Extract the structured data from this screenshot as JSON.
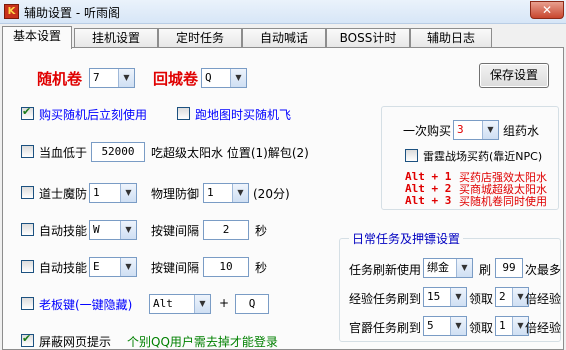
{
  "window": {
    "icon_text": "K",
    "title": "辅助设置 - 听雨阁",
    "close": "✕"
  },
  "tabs": [
    {
      "label": "基本设置",
      "active": true
    },
    {
      "label": "挂机设置",
      "active": false
    },
    {
      "label": "定时任务",
      "active": false
    },
    {
      "label": "自动喊话",
      "active": false
    },
    {
      "label": "BOSS计时",
      "active": false
    },
    {
      "label": "辅助日志",
      "active": false
    }
  ],
  "left": {
    "random_scroll": {
      "label": "随机卷",
      "value": "7"
    },
    "return_scroll": {
      "label": "回城卷",
      "value": "Q"
    },
    "buy_random_use": {
      "label": "购买随机后立刻使用",
      "checked": true
    },
    "run_map_buy": {
      "label": "跑地图时买随机飞",
      "checked": false
    },
    "low_hp": {
      "label": "当血低于",
      "value": "52000",
      "suffix": "吃超级太阳水 位置(1)解包(2)",
      "checked": false
    },
    "taoist_magic_def": {
      "label": "道士魔防",
      "value": "1",
      "phys_label": "物理防御",
      "phys_value": "1",
      "duration": "(20分)",
      "checked": false
    },
    "auto_skill_1": {
      "label": "自动技能",
      "key": "W",
      "interval_label": "按键间隔",
      "interval": "2",
      "unit": "秒",
      "checked": false
    },
    "auto_skill_2": {
      "label": "自动技能",
      "key": "E",
      "interval_label": "按键间隔",
      "interval": "10",
      "unit": "秒",
      "checked": false
    },
    "boss_key": {
      "label": "老板键(一键隐藏)",
      "modifier": "Alt",
      "plus": "+",
      "key": "Q",
      "checked": false
    },
    "block_web": {
      "label": "屏蔽网页提示",
      "checked": true,
      "note": "个别QQ用户需去掉才能登录"
    }
  },
  "right": {
    "save_button": "保存设置",
    "buy_once": {
      "label": "一次购买",
      "value": "3",
      "suffix": "组药水"
    },
    "thunder_buy": {
      "label": "雷霆战场买药(靠近NPC)",
      "checked": false
    },
    "hotkeys": [
      {
        "keys": "Alt + 1",
        "desc": "买药店强效太阳水"
      },
      {
        "keys": "Alt + 2",
        "desc": "买商城超级太阳水"
      },
      {
        "keys": "Alt + 3",
        "desc": "买随机卷同时使用"
      }
    ],
    "daily": {
      "title": "日常任务及押镖设置",
      "refresh_label": "任务刷新使用",
      "refresh_item": "绑金",
      "refresh_word": "刷",
      "refresh_count": "99",
      "refresh_suffix": "次最多",
      "exp_label": "经验任务刷到",
      "exp_value": "15",
      "claim_label": "领取",
      "exp_mult": "2",
      "mult_suffix": "倍经验",
      "rank_label": "官爵任务刷到",
      "rank_value": "5",
      "rank_mult": "1"
    }
  },
  "colors": {
    "red": "#e00000",
    "blue": "#0000ff",
    "green": "#008000",
    "group_title": "#0000c0"
  }
}
